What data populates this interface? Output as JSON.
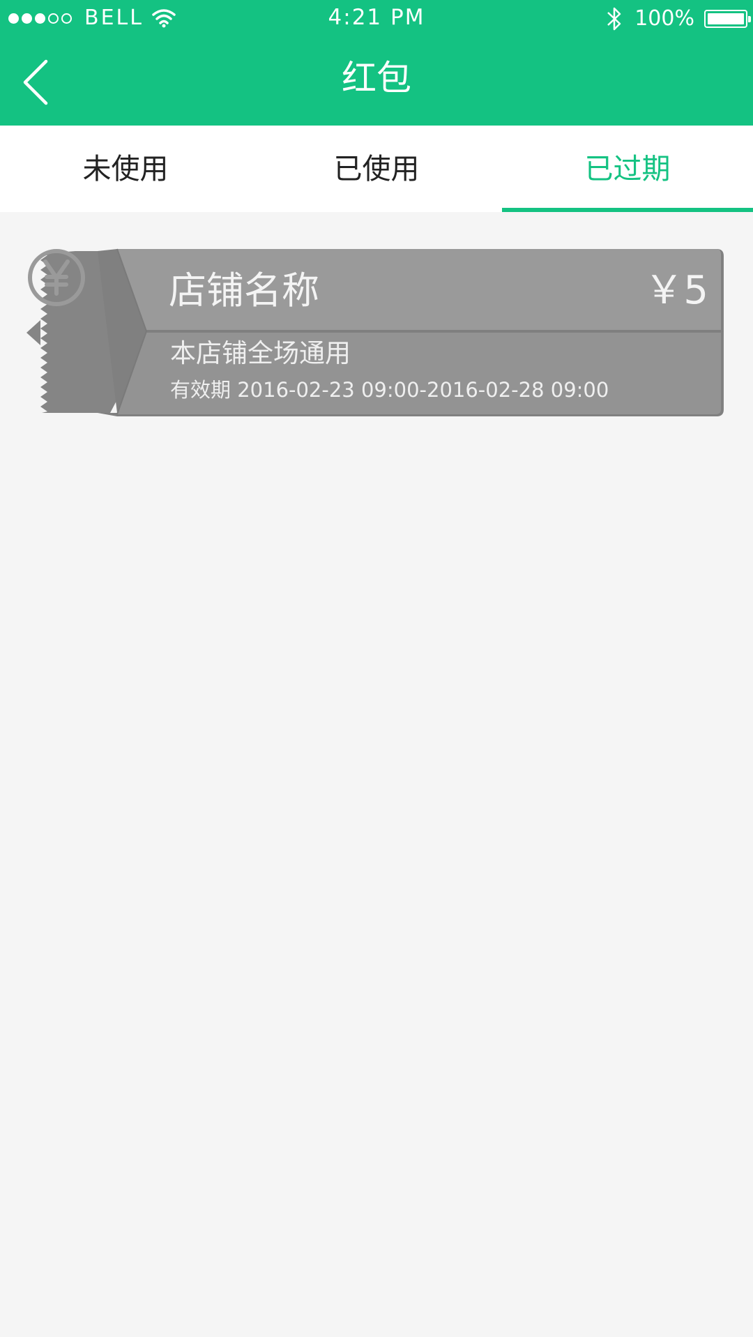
{
  "status_bar": {
    "carrier": "BELL",
    "time": "4:21 PM",
    "battery_percent": "100%",
    "signal_bars": 3,
    "signal_total": 5,
    "icons": [
      "wifi-icon",
      "bluetooth-icon",
      "battery-icon"
    ]
  },
  "nav": {
    "title": "红包",
    "back_icon": "chevron-left-icon"
  },
  "tabs": [
    {
      "label": "未使用",
      "active": false
    },
    {
      "label": "已使用",
      "active": false
    },
    {
      "label": "已过期",
      "active": true
    }
  ],
  "coupon": {
    "store_name": "店铺名称",
    "amount": "￥5",
    "scope": "本店铺全场通用",
    "validity": "有效期 2016-02-23 09:00-2016-02-28 09:00",
    "icon": "yuan-coin-icon",
    "state": "expired"
  },
  "colors": {
    "brand": "#14c282",
    "background": "#f5f5f5",
    "coupon_expired": "#969696",
    "coupon_stub": "#858585"
  }
}
